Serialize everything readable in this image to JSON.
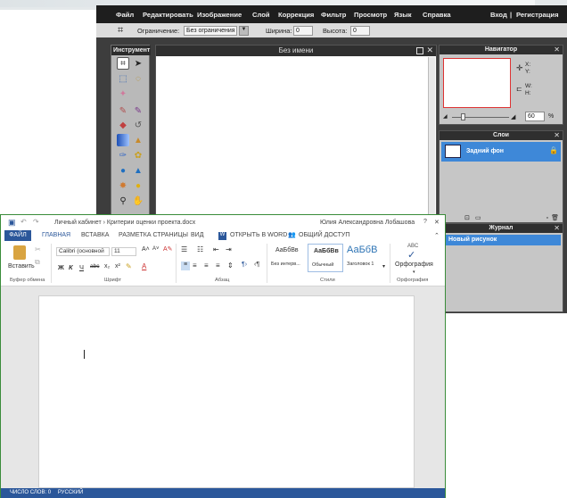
{
  "editor": {
    "menu": [
      "Файл",
      "Редактировать",
      "Изображение",
      "Слой",
      "Коррекция",
      "Фильтр",
      "Просмотр",
      "Язык",
      "Справка"
    ],
    "login": "Вход",
    "separator": "|",
    "register": "Регистрация",
    "constraint_label": "Ограничение:",
    "constraint_value": "Без ограничения",
    "width_label": "Ширина:",
    "width_value": "0",
    "height_label": "Высота:",
    "height_value": "0",
    "toolbox_title": "Инструмент",
    "canvas_title": "Без имени",
    "navigator": {
      "title": "Навигатор",
      "x_label": "X:",
      "y_label": "Y:",
      "w_label": "W:",
      "h_label": "H:",
      "zoom": "60",
      "percent": "%"
    },
    "layers": {
      "title": "Слои",
      "items": [
        "Задний фон"
      ]
    },
    "journal": {
      "title": "Журнал",
      "items": [
        "Новый рисунок"
      ]
    }
  },
  "word": {
    "breadcrumb": "Личный кабинет › Критерии оценки проекта.docx",
    "user": "Юлия Александровна Лобашова",
    "help": "?",
    "close": "✕",
    "tabs": [
      "ФАЙЛ",
      "ГЛАВНАЯ",
      "ВСТАВКА",
      "РАЗМЕТКА СТРАНИЦЫ",
      "ВИД",
      "ОТКРЫТЬ В WORD",
      "ОБЩИЙ ДОСТУП"
    ],
    "paste": "Вставить",
    "font_name": "Calibri (основной",
    "font_size": "11",
    "styles": [
      {
        "preview": "АаБбВв",
        "name": "Без интерв..."
      },
      {
        "preview": "АаБбВв",
        "name": "Обычный"
      },
      {
        "preview": "АаБбВ",
        "name": "Заголовок 1"
      }
    ],
    "spelling_abc": "ABC",
    "spelling": "Орфография",
    "groups": [
      "Буфер обмена",
      "Шрифт",
      "Абзац",
      "Стили",
      "Орфография"
    ],
    "status_words": "ЧИСЛО СЛОВ: 0",
    "status_lang": "РУССКИЙ"
  }
}
